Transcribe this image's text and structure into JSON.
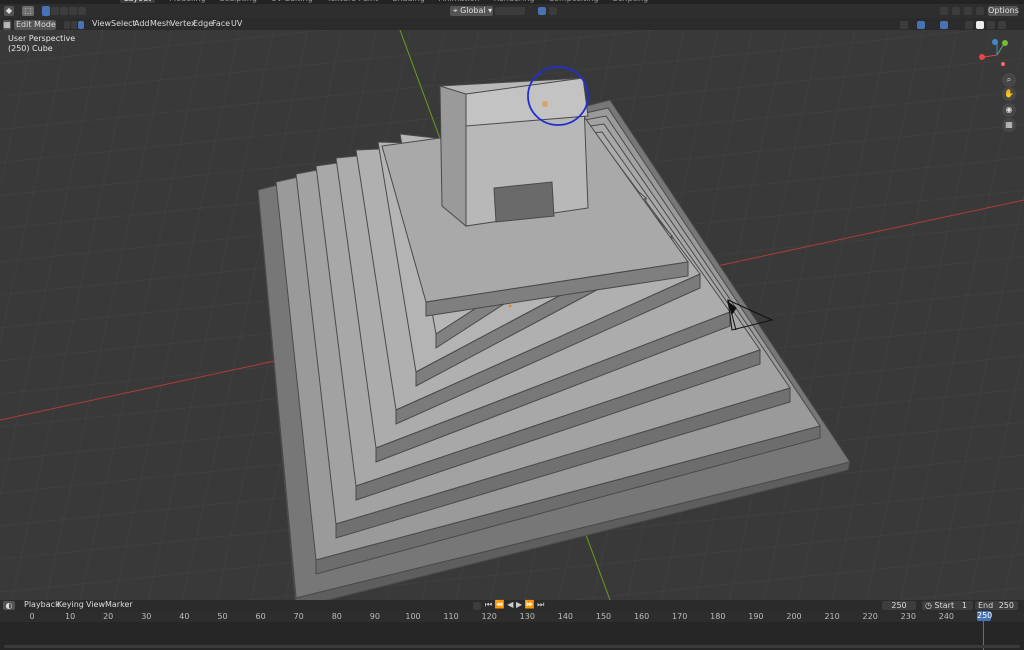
{
  "workspace_tabs": [
    "Layout",
    "Modeling",
    "Sculpting",
    "UV Editing",
    "Texture Paint",
    "Shading",
    "Animation",
    "Rendering",
    "Compositing",
    "Scripting"
  ],
  "header": {
    "mode": "Edit Mode",
    "menus": [
      "View",
      "Select",
      "Add",
      "Mesh",
      "Vertex",
      "Edge",
      "Face",
      "UV"
    ],
    "transform_orientation": "Global",
    "options": "Options"
  },
  "viewport": {
    "view_name": "User Perspective",
    "object_label": "(250) Cube"
  },
  "nav_icons": [
    "zoom-icon",
    "hand-icon",
    "camera-icon",
    "grid-icon"
  ],
  "timeline": {
    "menus": [
      "Playback",
      "Keying",
      "View",
      "Marker"
    ],
    "current_frame": "250",
    "start_label": "Start",
    "start_value": "1",
    "end_label": "End",
    "end_value": "250",
    "frame_ticks": [
      "0",
      "10",
      "20",
      "30",
      "40",
      "50",
      "60",
      "70",
      "80",
      "90",
      "100",
      "110",
      "120",
      "130",
      "140",
      "150",
      "160",
      "170",
      "180",
      "190",
      "200",
      "210",
      "220",
      "230",
      "240",
      "250"
    ]
  },
  "colors": {
    "accent": "#4772b3",
    "x_axis": "#c0392b",
    "y_axis": "#7fa91c",
    "mesh": "#8d8d8d"
  }
}
